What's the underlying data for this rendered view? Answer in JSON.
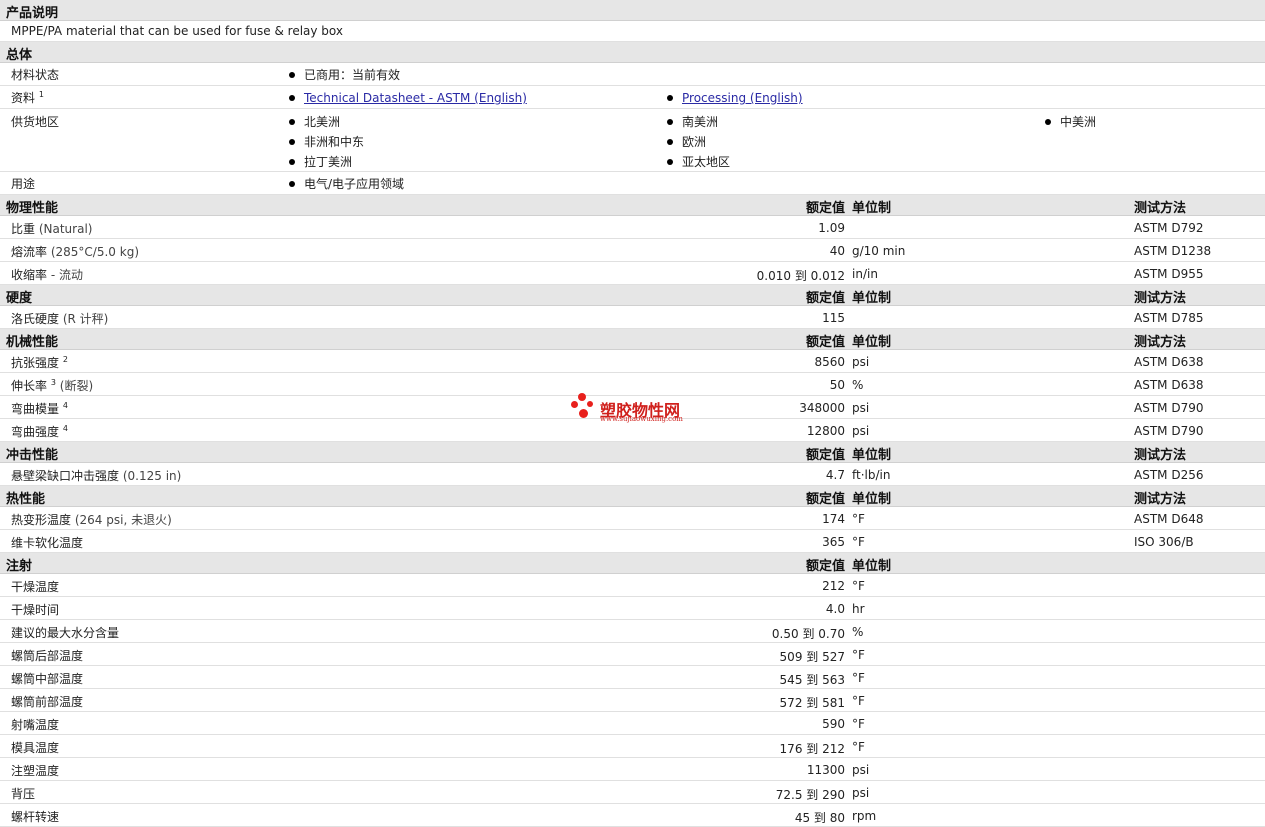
{
  "product": {
    "header": "产品说明",
    "description": "MPPE/PA material that can be used for fuse & relay box"
  },
  "general": {
    "header": "总体",
    "status_label": "材料状态",
    "status_value": "已商用：当前有效",
    "docs_label": "资料",
    "docs_sup": "1",
    "doc_link_1": "Technical Datasheet - ASTM (English)",
    "doc_link_2": "Processing (English)",
    "region_label": "供货地区",
    "regions": [
      "北美洲",
      "南美洲",
      "中美洲",
      "非洲和中东",
      "欧洲",
      "拉丁美洲",
      "亚太地区"
    ],
    "use_label": "用途",
    "use_value": "电气/电子应用领域"
  },
  "columns": {
    "value": "额定值",
    "unit": "单位制",
    "test": "测试方法"
  },
  "physical": {
    "header": "物理性能",
    "rows": [
      {
        "label": "比重",
        "sub": "(Natural)",
        "value": "1.09",
        "unit": "",
        "test": "ASTM D792"
      },
      {
        "label": "熔流率",
        "sub": "(285°C/5.0 kg)",
        "value": "40",
        "unit": "g/10 min",
        "test": "ASTM D1238"
      },
      {
        "label": "收缩率",
        "sub": "- 流动",
        "value": "0.010 到 0.012",
        "unit": "in/in",
        "test": "ASTM D955"
      }
    ]
  },
  "hardness": {
    "header": "硬度",
    "rows": [
      {
        "label": "洛氏硬度",
        "sub": "(R 计秤)",
        "value": "115",
        "unit": "",
        "test": "ASTM D785"
      }
    ]
  },
  "mechanical": {
    "header": "机械性能",
    "rows": [
      {
        "label": "抗张强度",
        "sup": "2",
        "sub": "",
        "value": "8560",
        "unit": "psi",
        "test": "ASTM D638"
      },
      {
        "label": "伸长率",
        "sup": "3",
        "sub": "(断裂)",
        "value": "50",
        "unit": "%",
        "test": "ASTM D638"
      },
      {
        "label": "弯曲模量",
        "sup": "4",
        "sub": "",
        "value": "348000",
        "unit": "psi",
        "test": "ASTM D790"
      },
      {
        "label": "弯曲强度",
        "sup": "4",
        "sub": "",
        "value": "12800",
        "unit": "psi",
        "test": "ASTM D790"
      }
    ]
  },
  "impact": {
    "header": "冲击性能",
    "rows": [
      {
        "label": "悬壁梁缺口冲击强度",
        "sub": "(0.125 in)",
        "value": "4.7",
        "unit": "ft·lb/in",
        "test": "ASTM D256"
      }
    ]
  },
  "thermal": {
    "header": "热性能",
    "rows": [
      {
        "label": "热变形温度",
        "sub": "(264 psi, 未退火)",
        "value": "174",
        "unit": "°F",
        "test": "ASTM D648"
      },
      {
        "label": "维卡软化温度",
        "sub": "",
        "value": "365",
        "unit": "°F",
        "test": "ISO 306/B"
      }
    ]
  },
  "injection": {
    "header": "注射",
    "rows": [
      {
        "label": "干燥温度",
        "value": "212",
        "unit": "°F"
      },
      {
        "label": "干燥时间",
        "value": "4.0",
        "unit": "hr"
      },
      {
        "label": "建议的最大水分含量",
        "value": "0.50 到 0.70",
        "unit": "%"
      },
      {
        "label": "螺筒后部温度",
        "value": "509 到 527",
        "unit": "°F"
      },
      {
        "label": "螺筒中部温度",
        "value": "545 到 563",
        "unit": "°F"
      },
      {
        "label": "螺筒前部温度",
        "value": "572 到 581",
        "unit": "°F"
      },
      {
        "label": "射嘴温度",
        "value": "590",
        "unit": "°F"
      },
      {
        "label": "模具温度",
        "value": "176 到 212",
        "unit": "°F"
      },
      {
        "label": "注塑温度",
        "value": "11300",
        "unit": "psi"
      },
      {
        "label": "背压",
        "value": "72.5 到 290",
        "unit": "psi"
      },
      {
        "label": "螺杆转速",
        "value": "45 到 80",
        "unit": "rpm"
      }
    ]
  },
  "watermark": {
    "name": "塑胶物性网",
    "url": "www.sujiaowuxing.com",
    "color": "#e8201c"
  }
}
